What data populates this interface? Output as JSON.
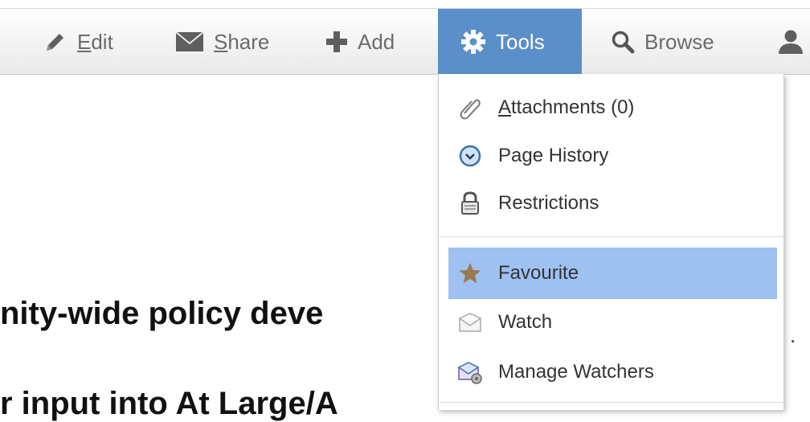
{
  "toolbar": {
    "buttons": [
      {
        "label": "Edit",
        "accel": "E",
        "rest": "dit",
        "icon": "pencil-icon"
      },
      {
        "label": "Share",
        "accel": "S",
        "rest": "hare",
        "icon": "envelope-icon"
      },
      {
        "label": "Add",
        "icon": "plus-icon"
      },
      {
        "label": "Tools",
        "icon": "gear-icon",
        "active": true
      },
      {
        "label": "Browse",
        "icon": "magnifier-icon"
      },
      {
        "label": "",
        "icon": "user-icon"
      }
    ]
  },
  "tools_menu": {
    "groups": [
      [
        {
          "label": "Attachments (0)",
          "accel": "A",
          "rest": "ttachments (0)",
          "icon": "paperclip-icon"
        },
        {
          "label": "Page History",
          "icon": "clock-icon"
        },
        {
          "label": "Restrictions",
          "icon": "padlock-icon"
        }
      ],
      [
        {
          "label": "Favourite",
          "icon": "star-icon",
          "highlighted": true
        },
        {
          "label": "Watch",
          "icon": "envelope-watch-icon"
        },
        {
          "label": "Manage Watchers",
          "icon": "watchers-icon"
        }
      ]
    ]
  },
  "page": {
    "heading_partial_1": "nity-wide policy deve",
    "heading_partial_2": "r input into At Large/A"
  },
  "colors": {
    "active_tab": "#5b8fc9",
    "highlight": "#9ec1f2",
    "star": "#9b7a4e"
  }
}
